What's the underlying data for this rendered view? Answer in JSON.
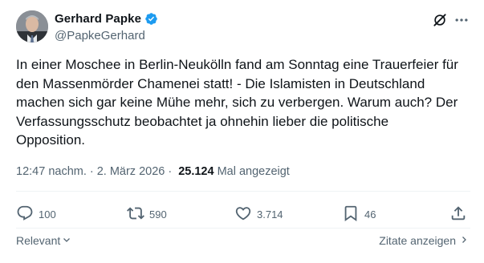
{
  "author": {
    "display_name": "Gerhard Papke",
    "handle": "@PapkeGerhard",
    "verified": true
  },
  "header_icons": {
    "grok": "grok-slash-icon",
    "more": "more-dots-icon"
  },
  "tweet": {
    "text": "In einer Moschee in Berlin-Neukölln fand am Sonntag eine Trauerfeier für\nden Massenmörder Chamenei statt! - Die Islamisten in Deutschland\nmachen sich gar keine Mühe mehr, sich zu verbergen. Warum auch? Der\nVerfassungsschutz beobachtet ja ohnehin lieber die politische\nOpposition.",
    "time": "12:47 nachm.",
    "separator": "·",
    "date": "2. März 2026",
    "views": "25.124",
    "views_label": "Mal angezeigt"
  },
  "actions": {
    "replies": "100",
    "reposts": "590",
    "likes": "3.714",
    "bookmarks": "46"
  },
  "footer": {
    "relevant_label": "Relevant",
    "quotes_label": "Zitate anzeigen"
  },
  "colors": {
    "text": "#0f1419",
    "secondary": "#536471",
    "verified": "#1d9bf0",
    "divider": "#eff3f4"
  }
}
